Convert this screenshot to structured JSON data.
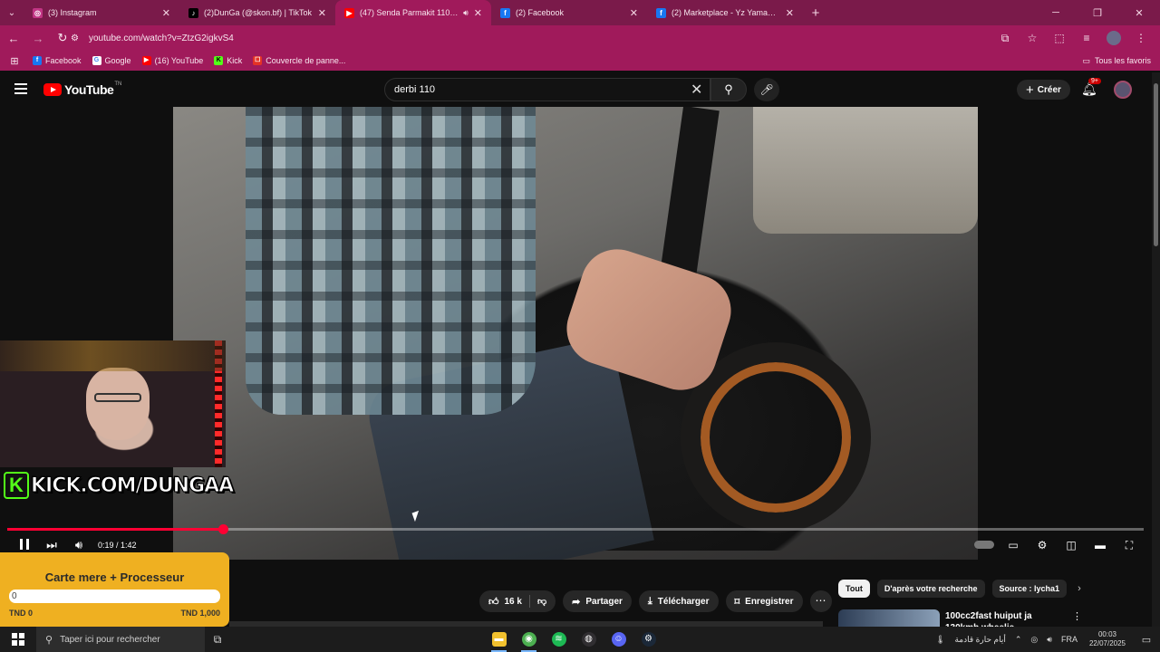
{
  "browser": {
    "tabs": [
      {
        "label": "(3) Instagram",
        "icon": "instagram-icon",
        "color": "#c13584",
        "active": false
      },
      {
        "label": "(2)DunGa (@skon.bf) | TikTok",
        "icon": "tiktok-icon",
        "color": "#000000",
        "active": false
      },
      {
        "label": "(47) Senda Parmakit 110 - Y",
        "icon": "youtube-icon",
        "color": "#ff0000",
        "active": true
      },
      {
        "label": "(2) Facebook",
        "icon": "facebook-icon",
        "color": "#1877f2",
        "active": false
      },
      {
        "label": "(2) Marketplace - Yz Yamaha 🔥",
        "icon": "facebook-icon",
        "color": "#1877f2",
        "active": false
      }
    ],
    "url": "youtube.com/watch?v=ZtzG2igkvS4",
    "bookmarks": [
      {
        "label": "Facebook",
        "icon": "facebook-icon",
        "color": "#1877f2"
      },
      {
        "label": "Google",
        "icon": "google-icon",
        "color": "#ffffff"
      },
      {
        "label": "(16) YouTube",
        "icon": "youtube-icon",
        "color": "#ff0000"
      },
      {
        "label": "Kick",
        "icon": "kick-icon",
        "color": "#53fc18"
      },
      {
        "label": "Couvercle de panne...",
        "icon": "aliexpress-icon",
        "color": "#e43225"
      }
    ],
    "all_bookmarks": "Tous les favoris",
    "accent": "#a01a5b"
  },
  "youtube": {
    "logo": "YouTube",
    "logo_suffix": "TN",
    "search_value": "derbi 110",
    "create_label": "Créer",
    "notif_badge": "9+",
    "player": {
      "current_time": "0:19 / 1:42",
      "progress_fraction": 0.19
    },
    "actions": {
      "likes": "16 k",
      "share": "Partager",
      "download": "Télécharger",
      "save": "Enregistrer"
    },
    "chips": [
      "Tout",
      "D'après votre recherche",
      "Source : lycha1"
    ],
    "recommendation": {
      "title": "100cc2fast huiput ja 130kmh wheelie"
    }
  },
  "overlay": {
    "kick_text": "KICK.COM/DUNGAA",
    "goal": {
      "title": "Carte mere + Processeur",
      "current": "0",
      "min_label": "TND 0",
      "max_label": "TND 1,000",
      "fraction": 0
    }
  },
  "taskbar": {
    "search_placeholder": "Taper ici pour rechercher",
    "weather": "أيام حارة قادمة",
    "language": "FRA",
    "time": "00:03",
    "date": "22/07/2025",
    "apps": [
      {
        "name": "file-explorer-icon",
        "color": "#f2c12e"
      },
      {
        "name": "chrome-icon",
        "color": "#4caf50"
      },
      {
        "name": "spotify-icon",
        "color": "#1db954"
      },
      {
        "name": "obs-icon",
        "color": "#302e31"
      },
      {
        "name": "discord-icon",
        "color": "#5865f2"
      },
      {
        "name": "steam-icon",
        "color": "#1b2838"
      }
    ]
  }
}
